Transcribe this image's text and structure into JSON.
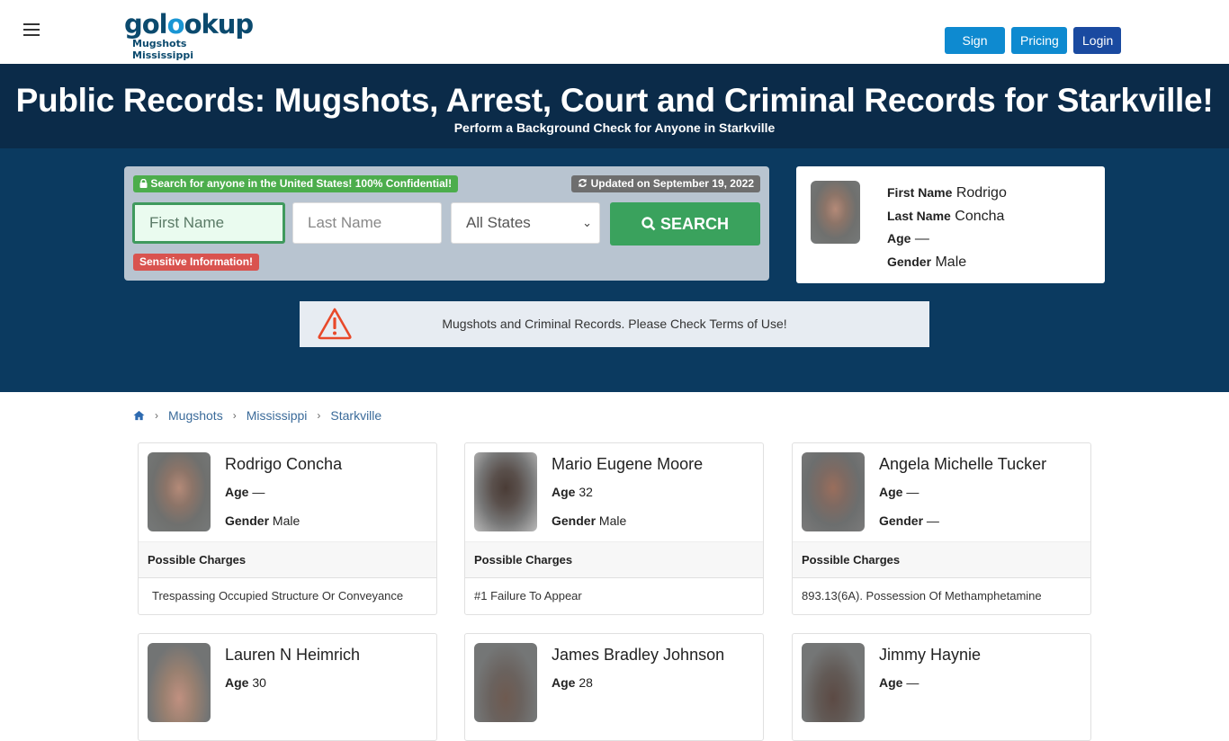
{
  "header": {
    "logo_main_a": "gol",
    "logo_main_o": "o",
    "logo_main_b": "okup",
    "logo_sub": "Mugshots Mississippi",
    "nav": {
      "signup": "Sign Up",
      "pricing": "Pricing",
      "login": "Login"
    }
  },
  "hero": {
    "title": "Public Records: Mugshots, Arrest, Court and Criminal Records for Starkville!",
    "subtitle": "Perform a Background Check for Anyone in Starkville"
  },
  "search": {
    "confidential_badge": "Search for anyone in the United States! 100% Confidential!",
    "updated_badge": "Updated on September 19, 2022",
    "first_name_placeholder": "First Name",
    "last_name_placeholder": "Last Name",
    "state_selected": "All States",
    "search_button": "SEARCH",
    "sensitive_badge": "Sensitive Information!"
  },
  "featured": {
    "first_name_label": "First Name",
    "first_name": "Rodrigo",
    "last_name_label": "Last Name",
    "last_name": "Concha",
    "age_label": "Age",
    "age": "—",
    "gender_label": "Gender",
    "gender": "Male"
  },
  "notice": {
    "text": "Mugshots and Criminal Records. Please Check Terms of Use!"
  },
  "breadcrumb": [
    "Mugshots",
    "Mississippi",
    "Starkville"
  ],
  "labels": {
    "age": "Age",
    "gender": "Gender",
    "possible_charges": "Possible Charges"
  },
  "records": [
    {
      "name": "Rodrigo Concha",
      "age": "—",
      "gender": "Male",
      "charge": "Trespassing Occupied Structure Or Conveyance"
    },
    {
      "name": "Mario Eugene Moore",
      "age": "32",
      "gender": "Male",
      "charge": "#1 Failure To Appear"
    },
    {
      "name": "Angela Michelle Tucker",
      "age": "—",
      "gender": "—",
      "charge": "893.13(6A). Possession Of Methamphetamine"
    },
    {
      "name": "Lauren N Heimrich",
      "age": "30"
    },
    {
      "name": "James Bradley Johnson",
      "age": "28"
    },
    {
      "name": "Jimmy Haynie",
      "age": "—"
    }
  ]
}
